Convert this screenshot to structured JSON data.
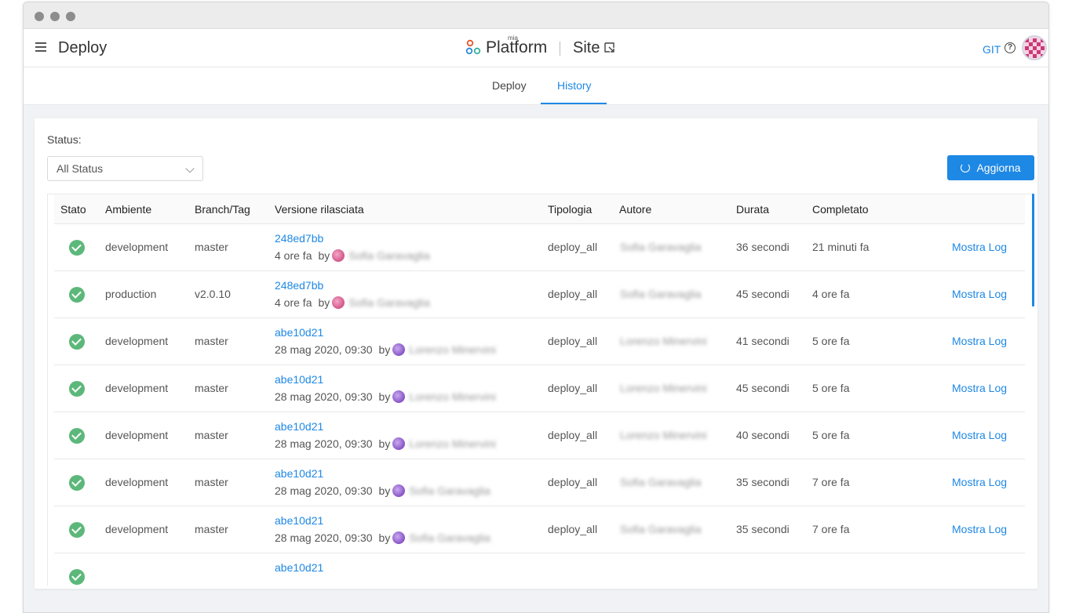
{
  "header": {
    "title": "Deploy",
    "logo_small": "mia",
    "logo_main": "Platform",
    "project": "Site",
    "git_label": "GIT",
    "help_glyph": "?"
  },
  "tabs": [
    {
      "label": "Deploy",
      "active": false
    },
    {
      "label": "History",
      "active": true
    }
  ],
  "filters": {
    "status_label": "Status:",
    "status_value": "All Status",
    "refresh_label": "Aggiorna"
  },
  "table": {
    "columns": [
      "Stato",
      "Ambiente",
      "Branch/Tag",
      "Versione rilasciata",
      "Tipologia",
      "Autore",
      "Durata",
      "Completato"
    ],
    "rows": [
      {
        "env": "development",
        "branch": "master",
        "version": "248ed7bb",
        "when": "4 ore fa",
        "by": "by",
        "author": "Sofia Garavaglia",
        "type": "deploy_all",
        "duration": "36 secondi",
        "completed": "21 minuti fa",
        "action": "Mostra Log"
      },
      {
        "env": "production",
        "branch": "v2.0.10",
        "version": "248ed7bb",
        "when": "4 ore fa",
        "by": "by",
        "author": "Sofia Garavaglia",
        "type": "deploy_all",
        "duration": "45 secondi",
        "completed": "4 ore fa",
        "action": "Mostra Log"
      },
      {
        "env": "development",
        "branch": "master",
        "version": "abe10d21",
        "when": "28 mag 2020, 09:30",
        "by": "by",
        "author": "Lorenzo Minervini",
        "type": "deploy_all",
        "duration": "41 secondi",
        "completed": "5 ore fa",
        "action": "Mostra Log"
      },
      {
        "env": "development",
        "branch": "master",
        "version": "abe10d21",
        "when": "28 mag 2020, 09:30",
        "by": "by",
        "author": "Lorenzo Minervini",
        "type": "deploy_all",
        "duration": "45 secondi",
        "completed": "5 ore fa",
        "action": "Mostra Log"
      },
      {
        "env": "development",
        "branch": "master",
        "version": "abe10d21",
        "when": "28 mag 2020, 09:30",
        "by": "by",
        "author": "Lorenzo Minervini",
        "type": "deploy_all",
        "duration": "40 secondi",
        "completed": "5 ore fa",
        "action": "Mostra Log"
      },
      {
        "env": "development",
        "branch": "master",
        "version": "abe10d21",
        "when": "28 mag 2020, 09:30",
        "by": "by",
        "author": "Sofia Garavaglia",
        "type": "deploy_all",
        "duration": "35 secondi",
        "completed": "7 ore fa",
        "action": "Mostra Log"
      },
      {
        "env": "development",
        "branch": "master",
        "version": "abe10d21",
        "when": "28 mag 2020, 09:30",
        "by": "by",
        "author": "Sofia Garavaglia",
        "type": "deploy_all",
        "duration": "35 secondi",
        "completed": "7 ore fa",
        "action": "Mostra Log"
      },
      {
        "env": "",
        "branch": "",
        "version": "abe10d21",
        "when": "",
        "by": "",
        "author": "",
        "type": "",
        "duration": "",
        "completed": "",
        "action": ""
      }
    ]
  },
  "colors": {
    "accent": "#1e88e5",
    "success": "#5cb87a"
  }
}
